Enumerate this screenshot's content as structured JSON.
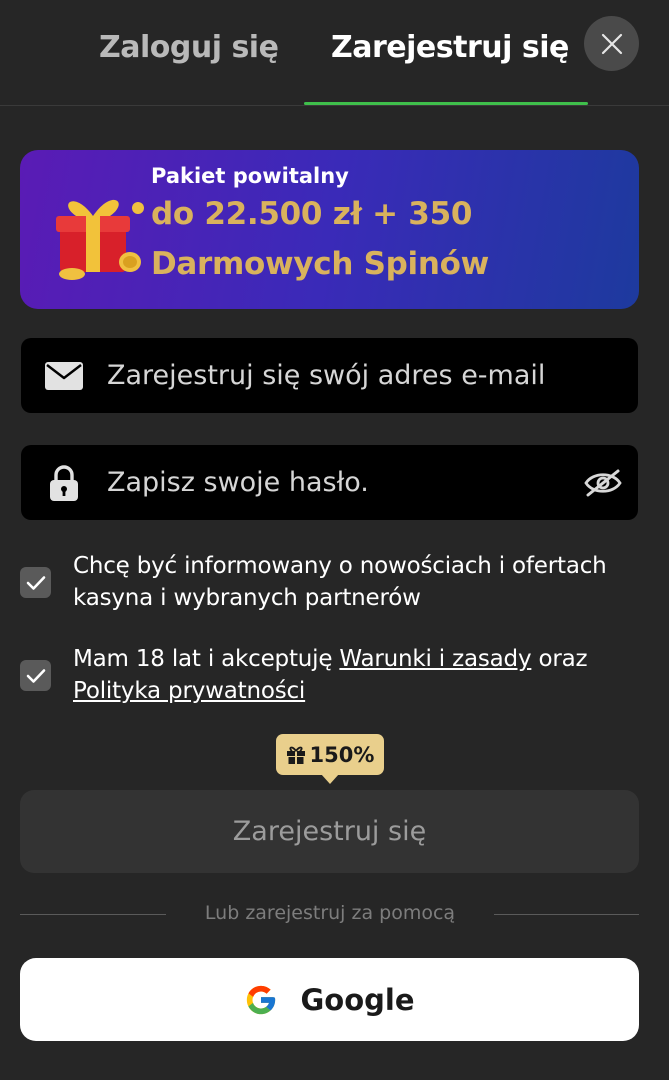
{
  "tabs": {
    "login": "Zaloguj się",
    "register": "Zarejestruj się"
  },
  "banner": {
    "label": "Pakiet powitalny",
    "amount": "do 22.500 zł + 350",
    "spins": "Darmowych Spinów"
  },
  "email": {
    "placeholder": "Zarejestruj się swój adres e-mail",
    "value": ""
  },
  "password": {
    "placeholder": "Zapisz swoje hasło.",
    "value": ""
  },
  "checkboxes": {
    "newsletter": "Chcę być informowany o nowościach i ofertach kasyna i wybranych partnerów",
    "terms_prefix": "Mam 18 lat i akceptuję ",
    "terms_link": "Warunki i zasady",
    "terms_mid": " oraz ",
    "privacy_link": "Polityka prywatności"
  },
  "bonus_badge": "150%",
  "submit_label": "Zarejestruj się",
  "divider_text": "Lub zarejestruj za pomocą",
  "google_label": "Google",
  "colors": {
    "background": "#262626",
    "accent": "#3fbf4b",
    "gold": "#d9b25d",
    "badge": "#e9cf8c"
  },
  "icons": {
    "close": "close-icon",
    "gift": "gift-icon",
    "email": "envelope-icon",
    "password": "lock-icon",
    "toggle": "eye-off-icon",
    "check": "checkmark-icon",
    "google": "google-icon"
  }
}
